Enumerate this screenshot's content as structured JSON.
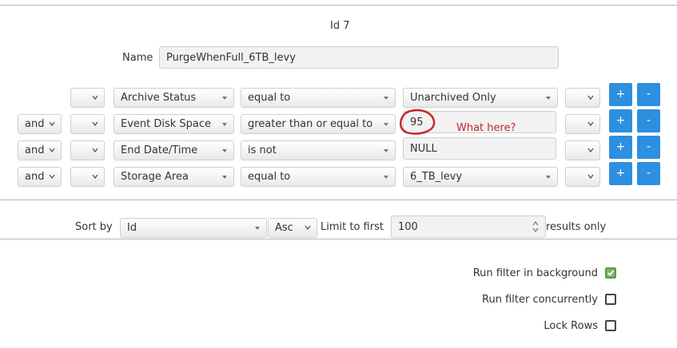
{
  "header": {
    "id_label": "Id 7"
  },
  "name_field": {
    "label": "Name",
    "value": "PurgeWhenFull_6TB_levy"
  },
  "rules": [
    {
      "conjunction": "",
      "paren_open": "",
      "field": "Archive Status",
      "operator": "equal to",
      "value": "Unarchived Only",
      "value_type": "select",
      "paren_close": "",
      "add_label": "+",
      "remove_label": "-"
    },
    {
      "conjunction": "and",
      "paren_open": "",
      "field": "Event Disk Space",
      "operator": "greater than or equal to",
      "value": "95",
      "value_type": "input",
      "paren_close": "",
      "add_label": "+",
      "remove_label": "-"
    },
    {
      "conjunction": "and",
      "paren_open": "",
      "field": "End Date/Time",
      "operator": "is not",
      "value": "NULL",
      "value_type": "input",
      "paren_close": "",
      "add_label": "+",
      "remove_label": "-"
    },
    {
      "conjunction": "and",
      "paren_open": "",
      "field": "Storage Area",
      "operator": "equal to",
      "value": "6_TB_levy",
      "value_type": "select",
      "paren_close": "",
      "add_label": "+",
      "remove_label": "-"
    }
  ],
  "annotation": {
    "text": "What here?",
    "color": "#c2272d"
  },
  "sort": {
    "label": "Sort by",
    "field": "Id",
    "direction": "Asc",
    "limit_label": "Limit to first",
    "limit_value": "100",
    "results_label": "results only"
  },
  "options": [
    {
      "label": "Run filter in background",
      "checked": true
    },
    {
      "label": "Run filter concurrently",
      "checked": false
    },
    {
      "label": "Lock Rows",
      "checked": false
    }
  ],
  "colors": {
    "button": "#2c8fe0",
    "checkbox_checked": "#7cb46b",
    "annotation": "#c2272d"
  }
}
